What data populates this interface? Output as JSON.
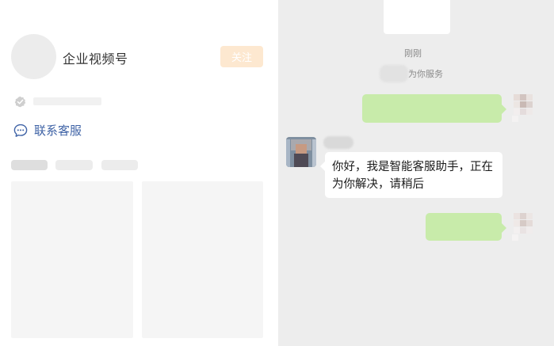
{
  "profile": {
    "channel_name": "企业视频号",
    "follow_label": "关注",
    "contact_label": "联系客服"
  },
  "chat": {
    "time_label": "刚刚",
    "system_message": "为你服务",
    "agent_message": "你好，我是智能客服助手，正在为你解决，请稍后"
  },
  "icons": {
    "verify": "verified-badge-icon",
    "contact": "chat-bubble-icon"
  },
  "colors": {
    "link_blue": "#3f63a6",
    "follow_bg": "#fde8d0",
    "chat_bg": "#ededed",
    "self_bubble": "#c8ebaa",
    "agent_bubble": "#ffffff"
  }
}
